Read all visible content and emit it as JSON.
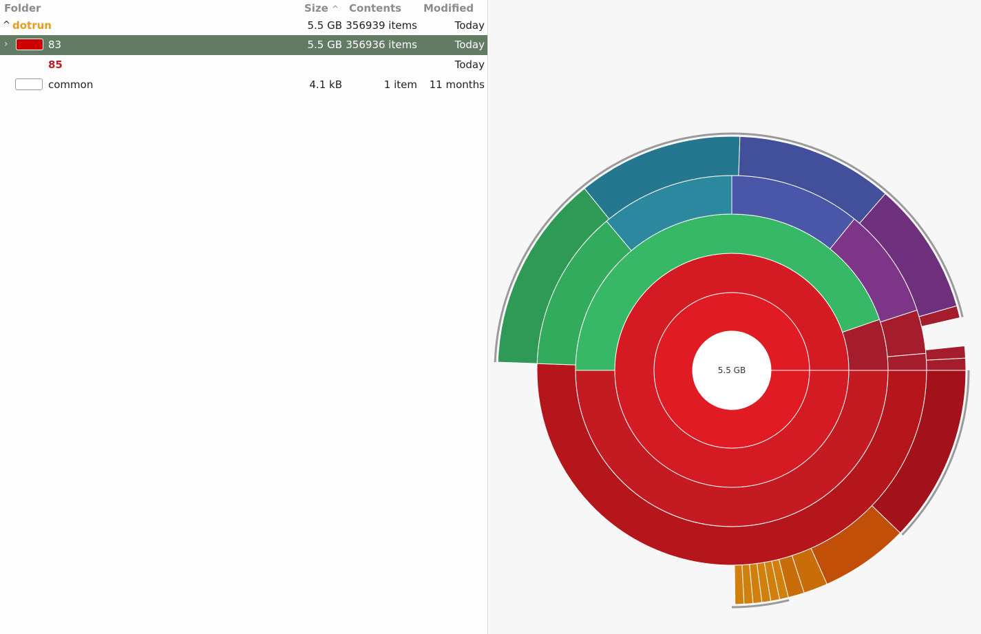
{
  "columns": {
    "folder": "Folder",
    "size": "Size",
    "sort_indicator": "^",
    "contents": "Contents",
    "modified": "Modified"
  },
  "rows": [
    {
      "expander": "^",
      "name": "dotrun",
      "size": "5.5 GB",
      "contents": "356939 items",
      "modified": "Today",
      "name_color": "#e79d1c"
    },
    {
      "expander": "›",
      "name": "83",
      "size": "5.5 GB",
      "contents": "356936 items",
      "modified": "Today",
      "swatch": "#cc0000"
    },
    {
      "expander": "",
      "name": "85",
      "size": "",
      "contents": "",
      "modified": "Today",
      "name_color": "#c01c28"
    },
    {
      "expander": "",
      "name": "common",
      "size": "4.1 kB",
      "contents": "1 item",
      "modified": "11 months",
      "swatch": "#ffffff"
    }
  ],
  "chart": {
    "center_label": "5.5 GB",
    "colors": {
      "selection": "#637a64",
      "red_1": "#e01b24",
      "red_2": "#d41b24",
      "red_3": "#c41a22",
      "red_4": "#b5161c",
      "red_5": "#a3121b",
      "crimson": "#a51d2d",
      "green_1": "#37b866",
      "green_2": "#33ab5d",
      "green_3": "#2f9a56",
      "teal_1": "#2b889f",
      "teal_2": "#25768f",
      "blue_1": "#4a57a8",
      "blue_2": "#42509c",
      "purple_1": "#7d3587",
      "purple_2": "#6e2f7c",
      "orange_1": "#c14f07",
      "orange_2": "#c96d0a",
      "orange_3": "#d1800f"
    }
  }
}
